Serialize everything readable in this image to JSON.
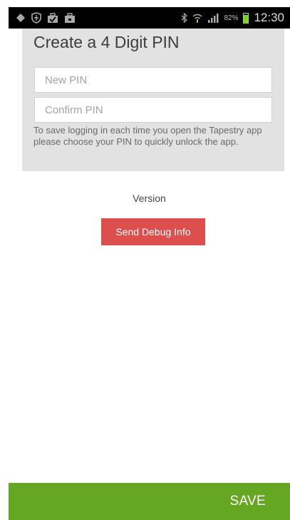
{
  "status_bar": {
    "left_icons": [
      "navigation-icon",
      "shield-icon",
      "briefcase-check-icon",
      "briefcase-icon"
    ],
    "right_icons": [
      "bluetooth-icon",
      "wifi-icon",
      "signal-icon"
    ],
    "battery_percent_label": "82%",
    "battery_level": 0.82,
    "time": "12:30"
  },
  "pin_setup": {
    "title": "Create a 4 Digit PIN",
    "new_pin_placeholder": "New PIN",
    "new_pin_value": "",
    "confirm_pin_placeholder": "Confirm PIN",
    "confirm_pin_value": "",
    "help_text": "To save logging in each time you open the Tapestry app please choose your PIN to quickly unlock the app."
  },
  "version_label": "Version",
  "debug_button_label": "Send Debug Info",
  "footer": {
    "save_label": "SAVE"
  },
  "colors": {
    "status_bar_bg": "#000000",
    "panel_bg": "#e2e2e2",
    "debug_button_bg": "#dc4f4c",
    "footer_bg": "#65a622",
    "battery_green": "#7ed321"
  }
}
